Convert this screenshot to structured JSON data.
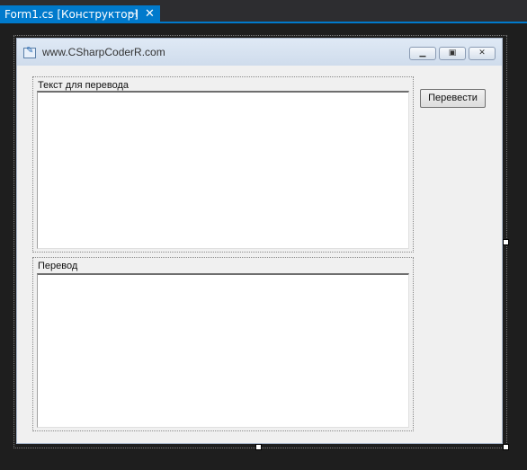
{
  "ide": {
    "tab_title": "Form1.cs [Конструктор]",
    "tab_pin_icon": "pin-icon",
    "tab_close_icon": "close-icon",
    "accent_color": "#007acc"
  },
  "form": {
    "title": "www.CSharpCoderR.com",
    "icon": "form-app-icon",
    "caption_buttons": [
      "minimize",
      "maximize",
      "close"
    ],
    "translate_button_label": "Перевести",
    "source_group_label": "Текст для перевода",
    "source_text": "",
    "result_group_label": "Перевод",
    "result_text": ""
  }
}
